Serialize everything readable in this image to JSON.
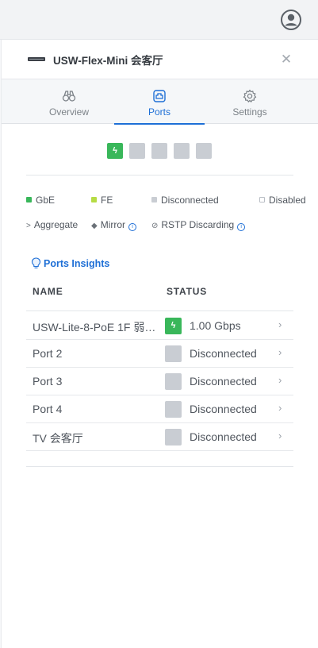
{
  "device": {
    "title": "USW-Flex-Mini 会客厅"
  },
  "tabs": [
    {
      "label": "Overview",
      "icon": "binoculars-icon"
    },
    {
      "label": "Ports",
      "icon": "port-icon",
      "active": true
    },
    {
      "label": "Settings",
      "icon": "gear-icon"
    }
  ],
  "port_strip": [
    "up",
    "down",
    "down",
    "down",
    "down"
  ],
  "legend": {
    "gbe": "GbE",
    "fe": "FE",
    "disconnected": "Disconnected",
    "disabled": "Disabled",
    "aggregate": "Aggregate",
    "mirror": "Mirror",
    "rstp": "RSTP Discarding"
  },
  "colors": {
    "gbe": "#39b75a",
    "fe": "#b6dc45",
    "disconnected": "#c9cdd3",
    "accent": "#1e6fd6"
  },
  "insights_label": "Ports Insights",
  "columns": {
    "name": "NAME",
    "status": "STATUS"
  },
  "ports": [
    {
      "name": "USW-Lite-8-PoE 1F 弱…",
      "status": "1.00 Gbps",
      "state": "up"
    },
    {
      "name": "Port 2",
      "status": "Disconnected",
      "state": "down"
    },
    {
      "name": "Port 3",
      "status": "Disconnected",
      "state": "down"
    },
    {
      "name": "Port 4",
      "status": "Disconnected",
      "state": "down"
    },
    {
      "name": "TV 会客厅",
      "status": "Disconnected",
      "state": "down"
    }
  ]
}
